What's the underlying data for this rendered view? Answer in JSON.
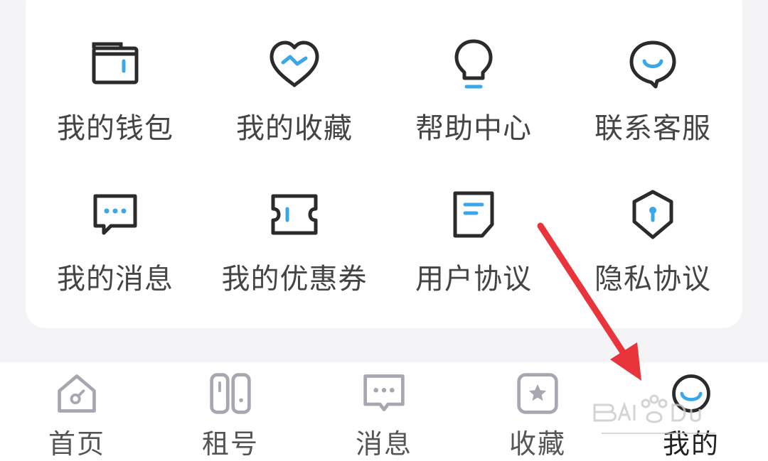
{
  "colors": {
    "icon_stroke": "#2b2b2b",
    "icon_accent": "#3aa7e8",
    "tab_icon": "#a7a7b3",
    "arrow": "#e8353b",
    "background": "#f4f4f6",
    "card": "#ffffff"
  },
  "menu": {
    "items": [
      {
        "label": "我的钱包",
        "icon": "wallet-icon"
      },
      {
        "label": "我的收藏",
        "icon": "heart-icon"
      },
      {
        "label": "帮助中心",
        "icon": "lightbulb-icon"
      },
      {
        "label": "联系客服",
        "icon": "customer-service-icon"
      },
      {
        "label": "我的消息",
        "icon": "message-icon"
      },
      {
        "label": "我的优惠券",
        "icon": "coupon-icon"
      },
      {
        "label": "用户协议",
        "icon": "document-icon"
      },
      {
        "label": "隐私协议",
        "icon": "shield-lock-icon"
      }
    ]
  },
  "tabbar": {
    "items": [
      {
        "label": "首页",
        "icon": "home-icon"
      },
      {
        "label": "租号",
        "icon": "gamepad-icon"
      },
      {
        "label": "消息",
        "icon": "chat-icon"
      },
      {
        "label": "收藏",
        "icon": "star-icon"
      },
      {
        "label": "我的",
        "icon": "profile-icon",
        "active": true
      }
    ]
  }
}
